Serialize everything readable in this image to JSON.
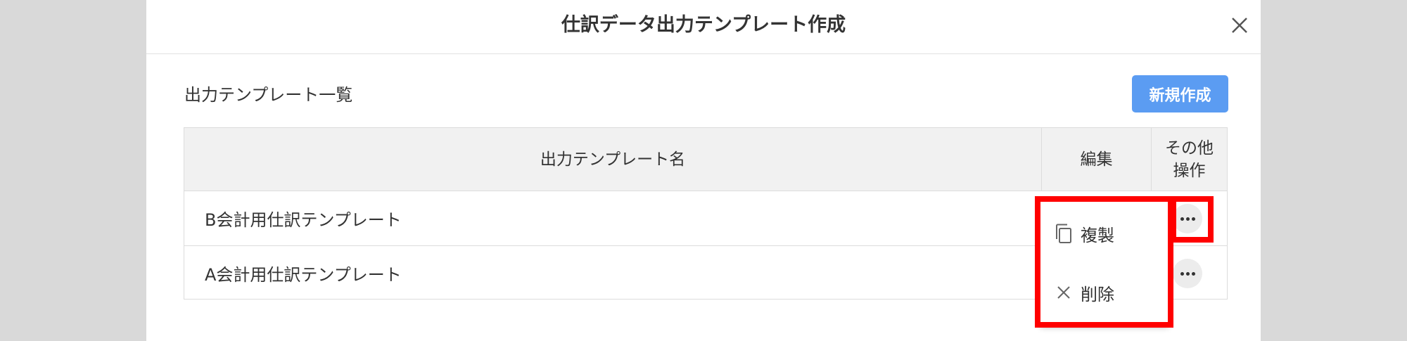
{
  "modal": {
    "title": "仕訳データ出力テンプレート作成"
  },
  "section": {
    "title": "出力テンプレート一覧",
    "new_button_label": "新規作成"
  },
  "table": {
    "headers": {
      "name": "出力テンプレート名",
      "edit": "編集",
      "other": "その他\n操作"
    },
    "rows": [
      {
        "name": "B会計用仕訳テンプレート"
      },
      {
        "name": "A会計用仕訳テンプレート"
      }
    ]
  },
  "menu": {
    "items": [
      {
        "label": "複製",
        "icon": "copy-icon"
      },
      {
        "label": "削除",
        "icon": "close-icon"
      }
    ]
  },
  "colors": {
    "primary_button": "#5b9cf2",
    "highlight": "#ff0000",
    "header_bg": "#f1f1f1",
    "backdrop": "#d9d9d9"
  }
}
